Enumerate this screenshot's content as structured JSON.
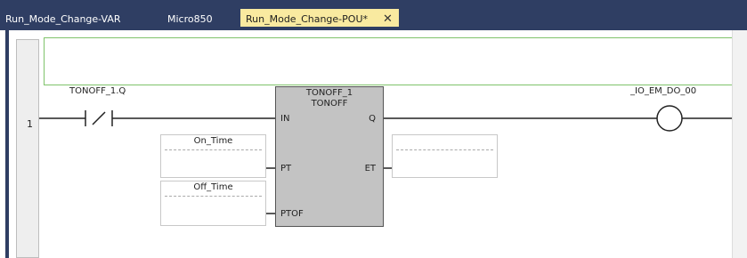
{
  "tabs": [
    {
      "label": "Run_Mode_Change-VAR",
      "active": false
    },
    {
      "label": "Micro850",
      "active": false
    },
    {
      "label": "Run_Mode_Change-POU*",
      "active": true
    }
  ],
  "tab_close_glyph": "✕",
  "rung": {
    "number": "1",
    "contact_label": "TONOFF_1.Q",
    "coil_label": "_IO_EM_DO_00"
  },
  "function_block": {
    "instance": "TONOFF_1",
    "type": "TONOFF",
    "inputs": [
      "IN",
      "PT",
      "PTOF"
    ],
    "outputs": [
      "Q",
      "ET"
    ]
  },
  "variables": {
    "pt_input": "On_Time",
    "ptof_input": "Off_Time",
    "et_output": ""
  },
  "colors": {
    "tab_bar": "#2f3e63",
    "active_tab": "#f9eaa0",
    "comment_border": "#7fc36b",
    "block_fill": "#c3c3c3"
  }
}
